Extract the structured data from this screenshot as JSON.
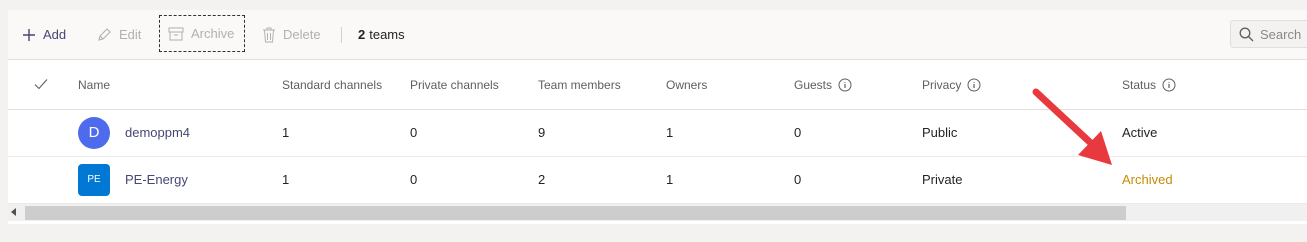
{
  "toolbar": {
    "add_label": "Add",
    "edit_label": "Edit",
    "archive_label": "Archive",
    "delete_label": "Delete",
    "count_number": "2",
    "count_suffix": "teams",
    "search_placeholder": "Search"
  },
  "table": {
    "headers": {
      "name": "Name",
      "standard_channels": "Standard channels",
      "private_channels": "Private channels",
      "team_members": "Team members",
      "owners": "Owners",
      "guests": "Guests",
      "privacy": "Privacy",
      "status": "Status"
    },
    "rows": [
      {
        "avatar": "D",
        "name": "demoppm4",
        "standard_channels": "1",
        "private_channels": "0",
        "team_members": "9",
        "owners": "1",
        "guests": "0",
        "privacy": "Public",
        "status": "Active"
      },
      {
        "avatar": "PE",
        "name": "PE-Energy",
        "standard_channels": "1",
        "private_channels": "0",
        "team_members": "2",
        "owners": "1",
        "guests": "0",
        "privacy": "Private",
        "status": "Archived"
      }
    ]
  },
  "colors": {
    "accent": "#464775",
    "archived_status": "#ca8a04",
    "callout_arrow": "#e8393f"
  },
  "icons": [
    "plus-icon",
    "pencil-icon",
    "archive-box-icon",
    "trash-icon",
    "search-icon",
    "checkmark-icon",
    "info-icon"
  ]
}
